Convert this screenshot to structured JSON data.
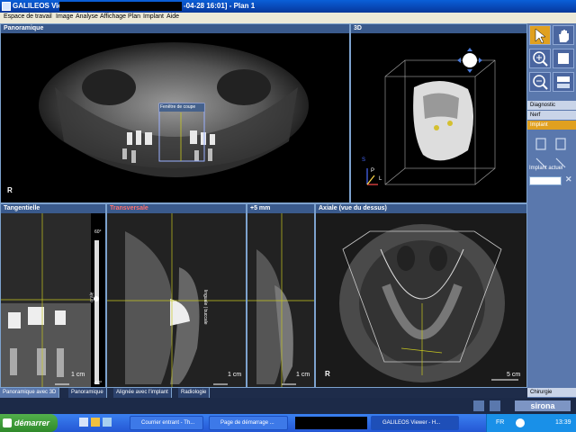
{
  "window": {
    "title_left": "GALILEOS Viewer",
    "title_right": "-04-28 16:01] - Plan 1"
  },
  "menu": [
    "Espace de travail",
    "Image",
    "Analyse",
    "Affichage",
    "Plan",
    "Implant",
    "Aide"
  ],
  "views": {
    "panoramic": {
      "title": "Panoramique",
      "overlay_label": "Fenêtre de coupe",
      "corner": "R"
    },
    "three_d": {
      "title": "3D",
      "axes": {
        "s": "S",
        "p": "P",
        "l": "L"
      }
    },
    "tangential": {
      "title": "Tangentielle",
      "scale": "1 cm",
      "slider_top": "60°",
      "slider_bottom": "-60°",
      "slider_label": "orale"
    },
    "transversal": {
      "title": "Transversale",
      "scale": "1 cm",
      "side_label": "linguale | buccale"
    },
    "plus5": {
      "title": "+5 mm",
      "scale": "1 cm"
    },
    "axial": {
      "title": "Axiale (vue du dessus)",
      "scale": "5 cm",
      "corner": "R"
    }
  },
  "right_panel": {
    "modes": [
      "Diagnostic",
      "Nerf",
      "Implant"
    ],
    "active_mode": "Implant",
    "implant_label": "Implant actuel",
    "surgery_label": "Chirurgie"
  },
  "tabs": [
    "Panoramique avec 3D",
    "Panoramique",
    "Alignée avec l'implant",
    "Radiologie"
  ],
  "active_tab": "Panoramique avec 3D",
  "brand": "sirona",
  "taskbar": {
    "start": "démarrer",
    "tasks": [
      "Courrier entrant - Th...",
      "Page de démarrage ...",
      "",
      "GALILEOS Viewer - H..."
    ],
    "language": "FR",
    "clock": "13:39"
  },
  "colors": {
    "accent": "#e0a020",
    "panel": "#5a78ad",
    "header": "#3a5a8c",
    "crosshair": "#c8c820"
  }
}
